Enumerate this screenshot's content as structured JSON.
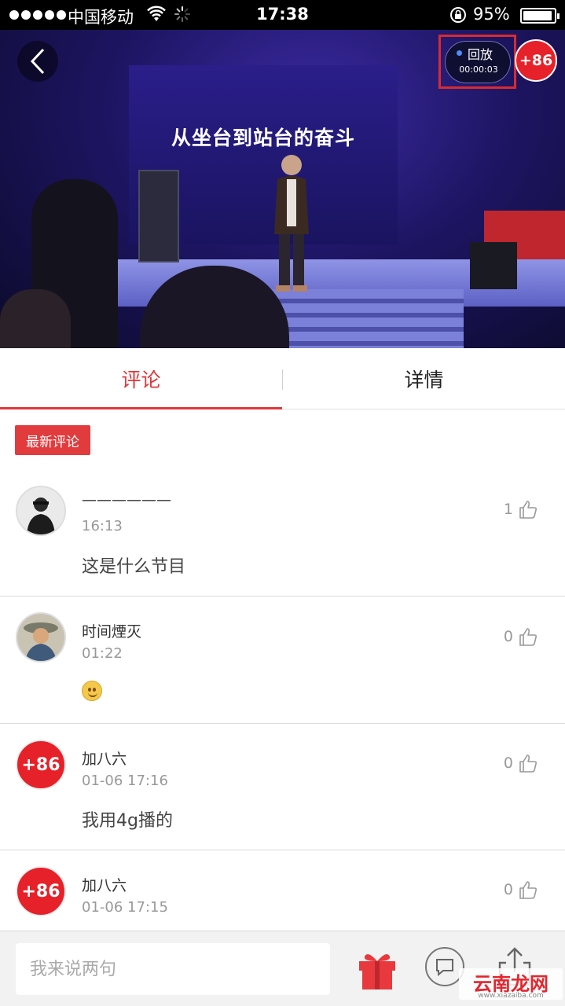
{
  "status_bar": {
    "carrier": "中国移动",
    "time": "17:38",
    "battery": "95%",
    "battery_level": 0.95
  },
  "video": {
    "screen_text": "从坐台到站台的奋斗",
    "replay_label": "回放",
    "replay_time": "00:00:03",
    "badge": "+86"
  },
  "tabs": [
    {
      "label": "评论",
      "active": true
    },
    {
      "label": "详情",
      "active": false
    }
  ],
  "latest_tag": "最新评论",
  "comments": [
    {
      "name": "——————",
      "time": "16:13",
      "text": "这是什么节目",
      "likes": "1",
      "avatar": "photo"
    },
    {
      "name": "时间煙灭",
      "time": "01:22",
      "text": "",
      "emoji": "smile-emoji",
      "likes": "0",
      "avatar": "photo"
    },
    {
      "name": "加八六",
      "time": "01-06 17:16",
      "text": "我用4g播的",
      "likes": "0",
      "avatar": "+86"
    },
    {
      "name": "加八六",
      "time": "01-06 17:15",
      "text": "",
      "likes": "0",
      "avatar": "+86"
    }
  ],
  "bottom_bar": {
    "input_placeholder": "我来说两句"
  },
  "watermark": {
    "text": "云南龙网",
    "url": "www.xiazaiba.com"
  },
  "colors": {
    "accent": "#e0363b",
    "brand_red": "#e62129"
  }
}
